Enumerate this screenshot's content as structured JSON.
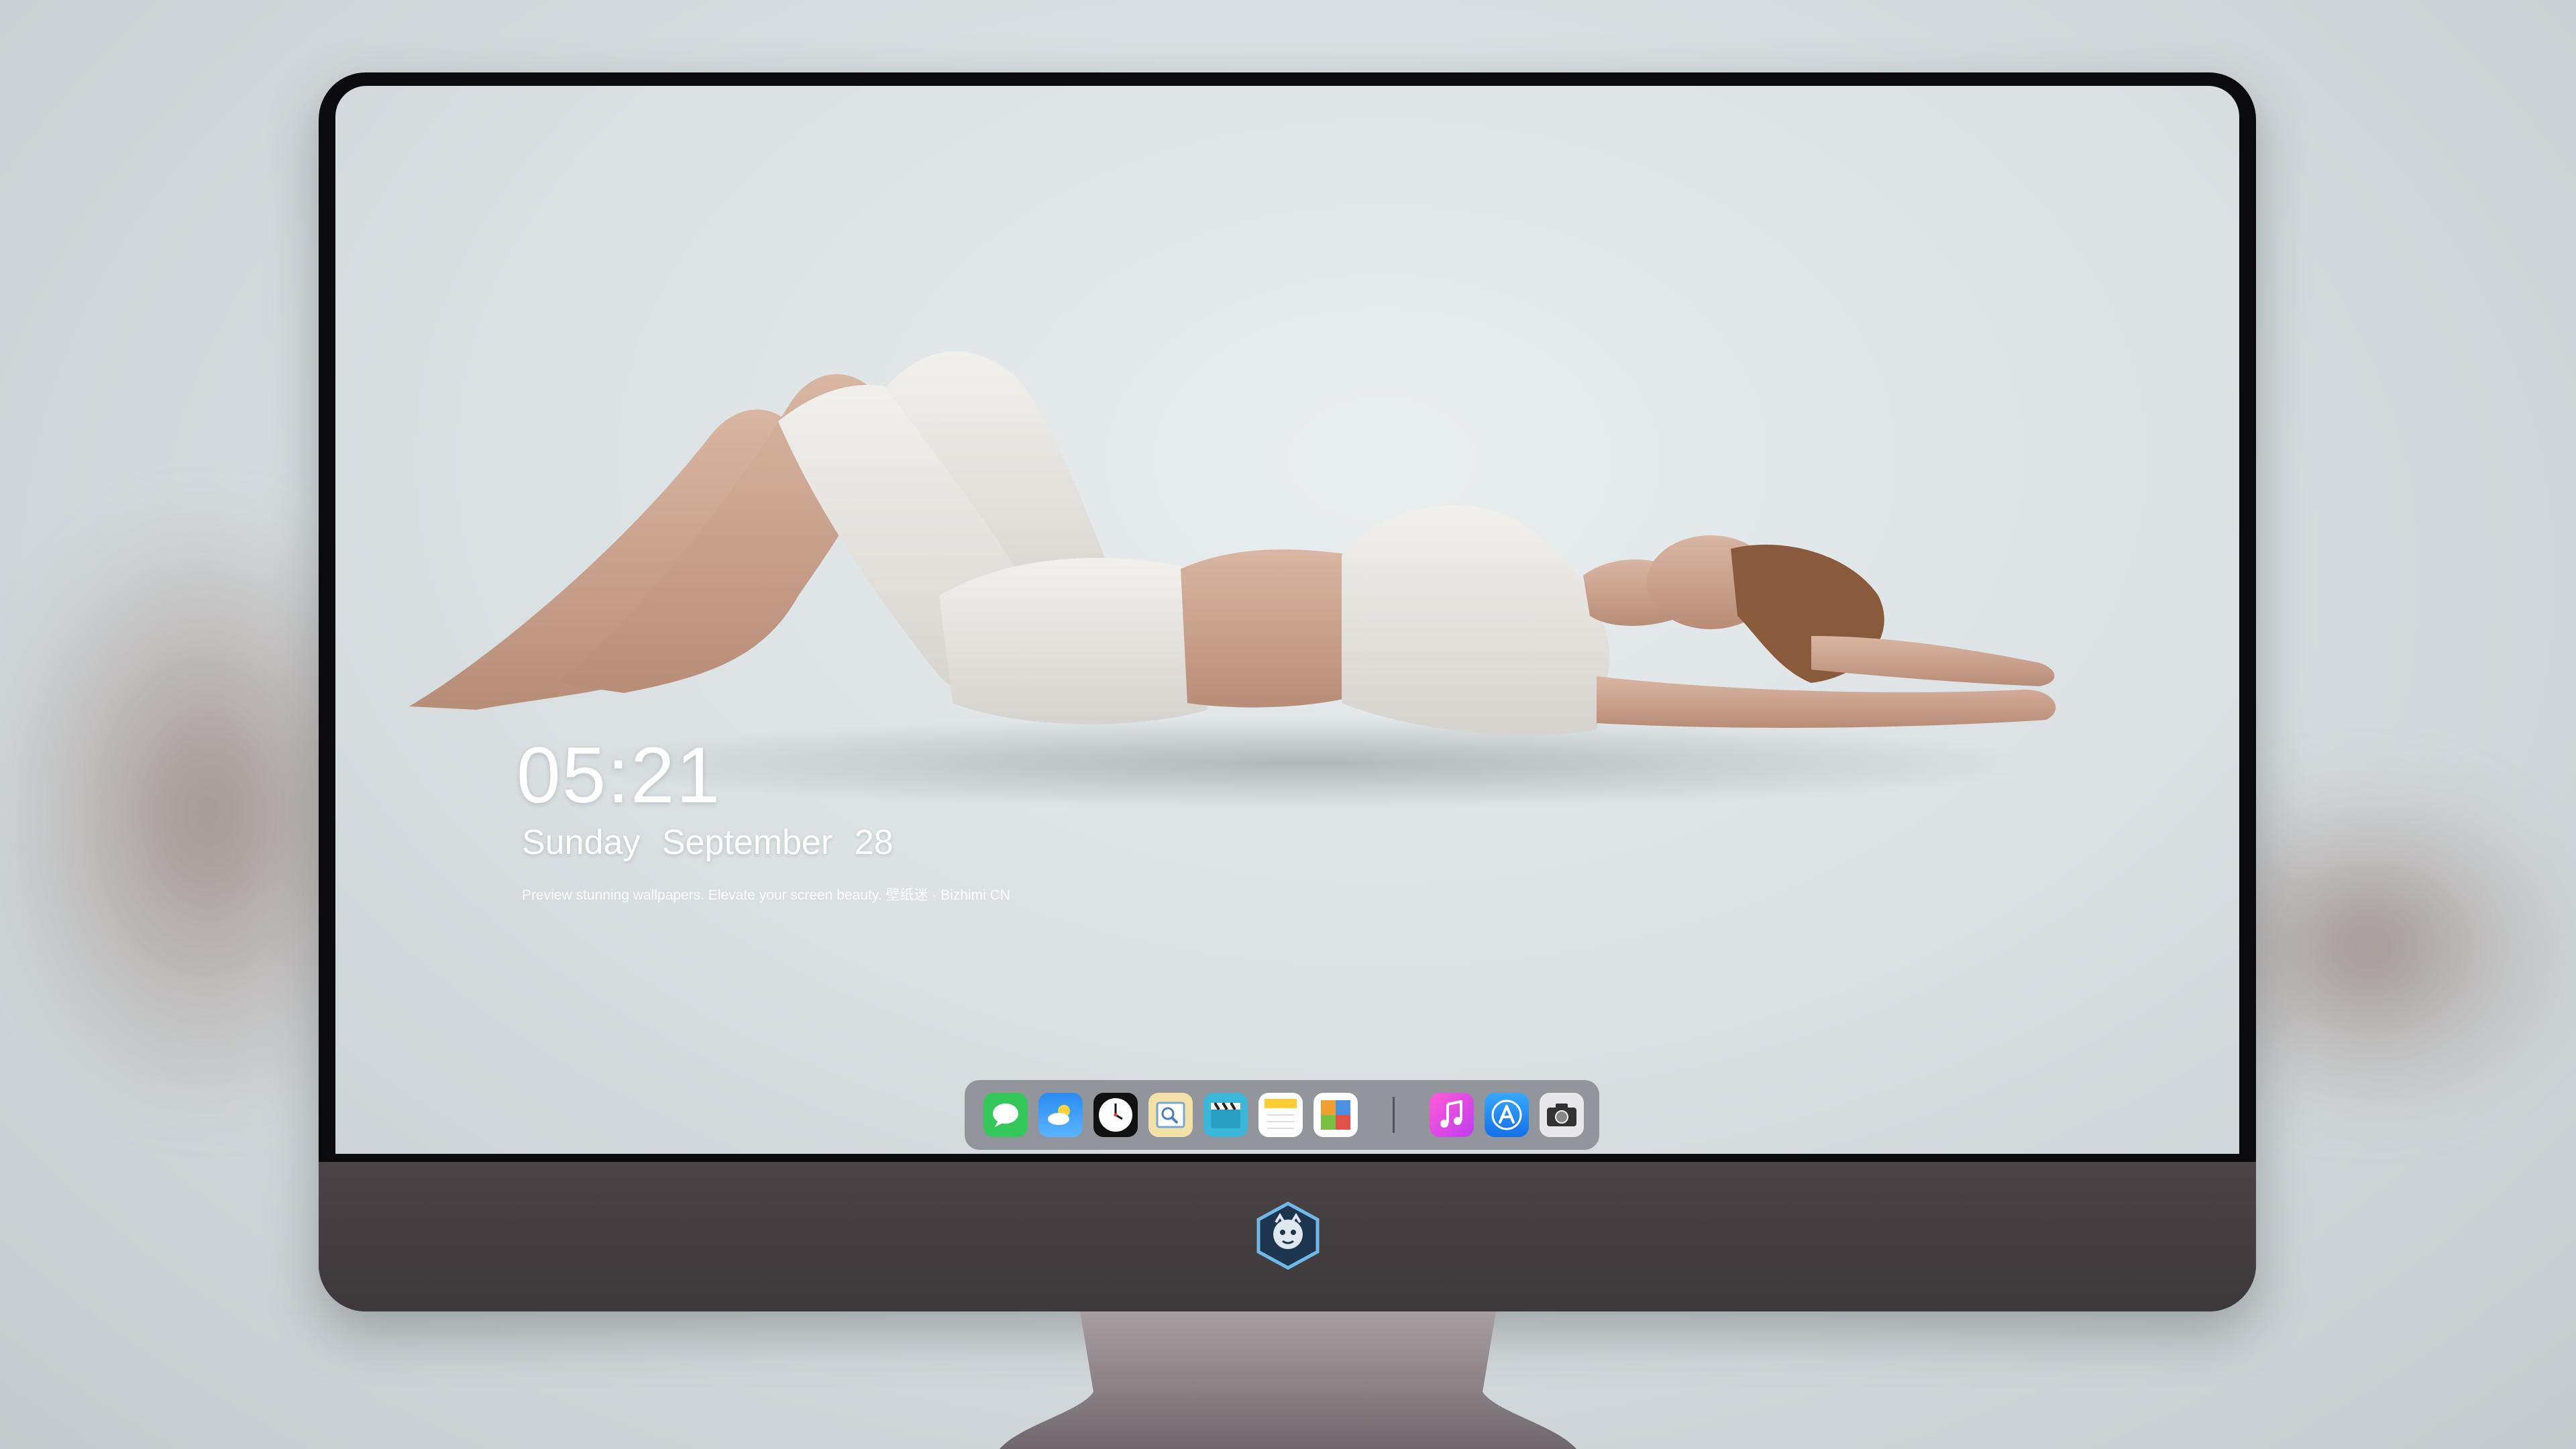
{
  "lock_screen": {
    "time": "05:21",
    "weekday": "Sunday",
    "month": "September",
    "day": "28",
    "caption": "Preview stunning wallpapers. Elevate your screen beauty. 壁纸迷 · Bizhimi CN"
  },
  "dock": {
    "apps": [
      {
        "name": "Messages",
        "icon": "messages-icon"
      },
      {
        "name": "Weather",
        "icon": "weather-icon"
      },
      {
        "name": "Clock",
        "icon": "clock-icon"
      },
      {
        "name": "Preview",
        "icon": "preview-icon"
      },
      {
        "name": "Video",
        "icon": "clapperboard-icon"
      },
      {
        "name": "Notes",
        "icon": "notes-icon"
      },
      {
        "name": "Photo Booth",
        "icon": "photo-gallery-icon"
      },
      {
        "name": "Music",
        "icon": "music-icon"
      },
      {
        "name": "App Store",
        "icon": "app-store-icon"
      },
      {
        "name": "Camera",
        "icon": "camera-icon"
      }
    ]
  },
  "colors": {
    "bezel": "#0b0b0d",
    "chin": "#4a4446",
    "wallpaper_bg": "#dde3e5",
    "dock_bg": "#5a5a64"
  }
}
